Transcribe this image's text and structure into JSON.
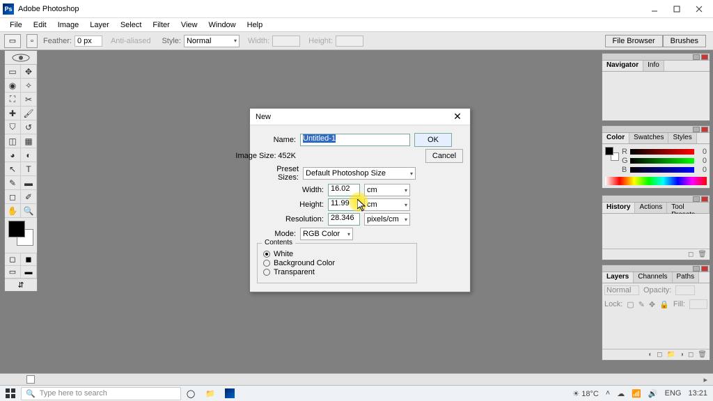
{
  "titlebar": {
    "app": "Adobe Photoshop"
  },
  "menus": [
    "File",
    "Edit",
    "Image",
    "Layer",
    "Select",
    "Filter",
    "View",
    "Window",
    "Help"
  ],
  "options": {
    "feather_label": "Feather:",
    "feather_value": "0 px",
    "antialias": "Anti-aliased",
    "style_label": "Style:",
    "style_value": "Normal",
    "width_label": "Width:",
    "height_label": "Height:",
    "tab_file": "File Browser",
    "tab_brushes": "Brushes"
  },
  "palettes": {
    "nav": {
      "tabs": [
        "Navigator",
        "Info"
      ]
    },
    "color": {
      "tabs": [
        "Color",
        "Swatches",
        "Styles"
      ],
      "r_label": "R",
      "r_val": "0",
      "g_label": "G",
      "g_val": "0",
      "b_label": "B",
      "b_val": "0"
    },
    "hist": {
      "tabs": [
        "History",
        "Actions",
        "Tool Presets"
      ]
    },
    "layer": {
      "tabs": [
        "Layers",
        "Channels",
        "Paths"
      ],
      "blend": "Normal",
      "opacity_lbl": "Opacity:",
      "lock_lbl": "Lock:",
      "fill_lbl": "Fill:"
    }
  },
  "dialog": {
    "title": "New",
    "name_label": "Name:",
    "name_value": "Untitled-1",
    "btn_ok": "OK",
    "btn_cancel": "Cancel",
    "image_size_label": "Image Size:",
    "image_size_value": "452K",
    "preset_label": "Preset Sizes:",
    "preset_value": "Default Photoshop Size",
    "width_label": "Width:",
    "width_value": "16.02",
    "width_unit": "cm",
    "height_label": "Height:",
    "height_value": "11.99",
    "height_unit": "cm",
    "res_label": "Resolution:",
    "res_value": "28.346",
    "res_unit": "pixels/cm",
    "mode_label": "Mode:",
    "mode_value": "RGB Color",
    "contents_legend": "Contents",
    "contents_white": "White",
    "contents_bg": "Background Color",
    "contents_trans": "Transparent"
  },
  "taskbar": {
    "search_placeholder": "Type here to search",
    "weather": "18°C",
    "lang": "ENG",
    "time": "13:21"
  }
}
